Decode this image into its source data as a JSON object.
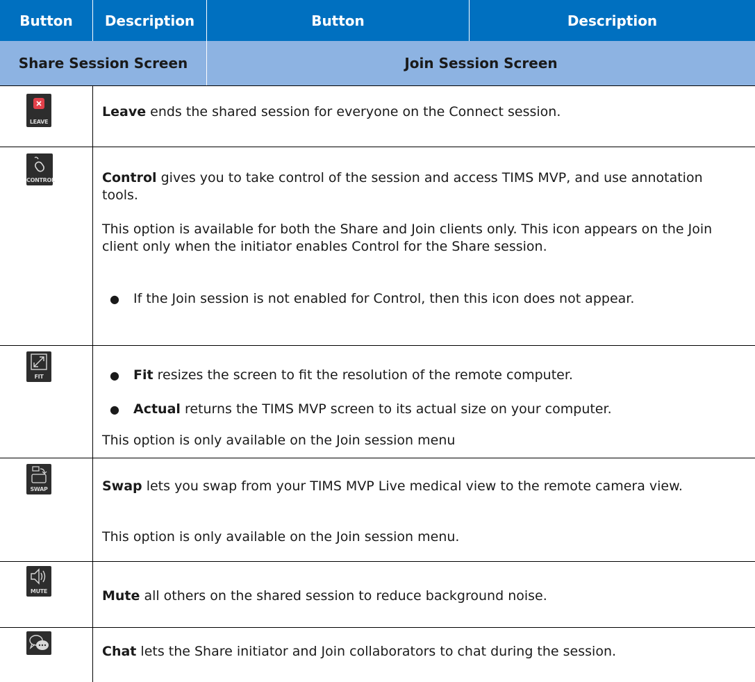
{
  "header": {
    "col1": "Button",
    "col2": "Description",
    "col3": "Button",
    "col4": "Description"
  },
  "sections": {
    "share": "Share Session Screen",
    "join": "Join Session Screen"
  },
  "rows": {
    "leave": {
      "icon_label": "LEAVE",
      "icon_name": "leave-icon",
      "term": "Leave",
      "rest": " ends the shared session for everyone on the Connect session."
    },
    "control": {
      "icon_label": "CONTROL",
      "icon_name": "mouse-cursor-icon",
      "term": "Control",
      "rest": " gives you to take control of the session and access TIMS MVP, and use annotation tools.",
      "para2": "This option is available for both the Share and Join clients only. This icon appears on the Join client only when the initiator enables Control for the Share session.",
      "bullet": "If the Join session is not enabled for Control, then this icon does not appear."
    },
    "fit": {
      "icon_label": "FIT",
      "icon_name": "fit-expand-icon",
      "b1_term": "Fit",
      "b1_rest": " resizes the screen to fit the resolution of the remote computer.",
      "b2_term": "Actual",
      "b2_rest": " returns the TIMS MVP screen to its actual size on your computer.",
      "note": "This option is only available on the Join session menu"
    },
    "swap": {
      "icon_label": "SWAP",
      "icon_name": "swap-icon",
      "term": "Swap",
      "rest": " lets you swap from your TIMS MVP Live medical view to the remote camera view.",
      "note": "This option is only available on the Join session menu."
    },
    "mute": {
      "icon_label": "MUTE",
      "icon_name": "speaker-icon",
      "term": "Mute",
      "rest": " all others on the shared session to reduce background noise."
    },
    "chat": {
      "icon_name": "chat-bubbles-icon",
      "term": "Chat",
      "rest": " lets the Share initiator and Join collaborators to chat during the session."
    }
  },
  "colors": {
    "header_bg": "#0070c0",
    "section_bg": "#8db3e2",
    "leave_red": "#e2404a"
  }
}
